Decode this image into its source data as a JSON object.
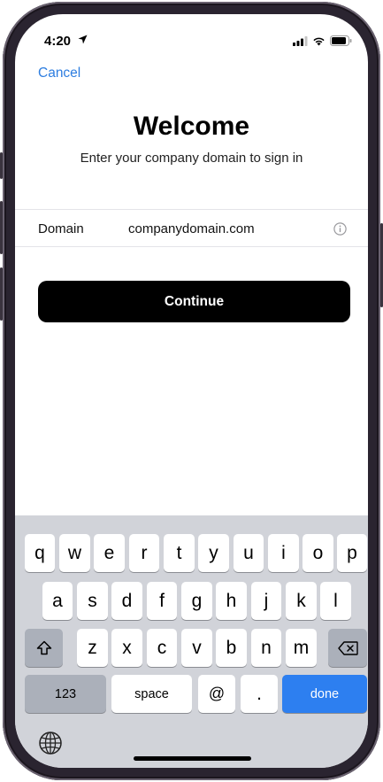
{
  "status_bar": {
    "time": "4:20"
  },
  "nav": {
    "cancel_label": "Cancel"
  },
  "header": {
    "title": "Welcome",
    "subtitle": "Enter your company domain to sign in"
  },
  "domain_field": {
    "label": "Domain",
    "value": "companydomain.com",
    "info_icon": "info-circle-icon"
  },
  "continue_label": "Continue",
  "keyboard": {
    "row1": [
      "q",
      "w",
      "e",
      "r",
      "t",
      "y",
      "u",
      "i",
      "o",
      "p"
    ],
    "row2": [
      "a",
      "s",
      "d",
      "f",
      "g",
      "h",
      "j",
      "k",
      "l"
    ],
    "row3": [
      "z",
      "x",
      "c",
      "v",
      "b",
      "n",
      "m"
    ],
    "numbers_label": "123",
    "space_label": "space",
    "at_label": "@",
    "dot_label": ".",
    "done_label": "done",
    "done_color": "#2d7ff0"
  },
  "colors": {
    "accent": "#2d7de0",
    "button_bg": "#000000",
    "keyboard_bg": "#d1d3d9"
  }
}
